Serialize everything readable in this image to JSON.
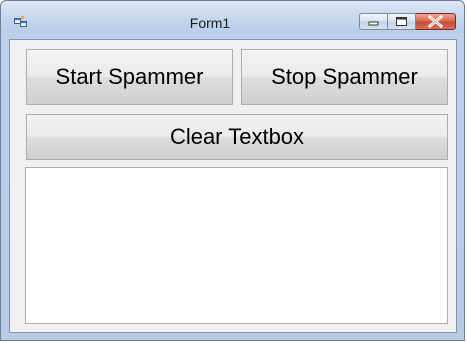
{
  "window": {
    "title": "Form1",
    "icons": {
      "app": "winforms-app-icon",
      "minimize": "minimize-icon",
      "maximize": "maximize-icon",
      "close": "close-icon"
    }
  },
  "buttons": {
    "start": "Start Spammer",
    "stop": "Stop Spammer",
    "clear": "Clear Textbox"
  },
  "textbox": {
    "value": ""
  },
  "colors": {
    "close_button": "#c54c35",
    "client_bg": "#f0f0f0",
    "title_bar": "#c6d8ef"
  }
}
